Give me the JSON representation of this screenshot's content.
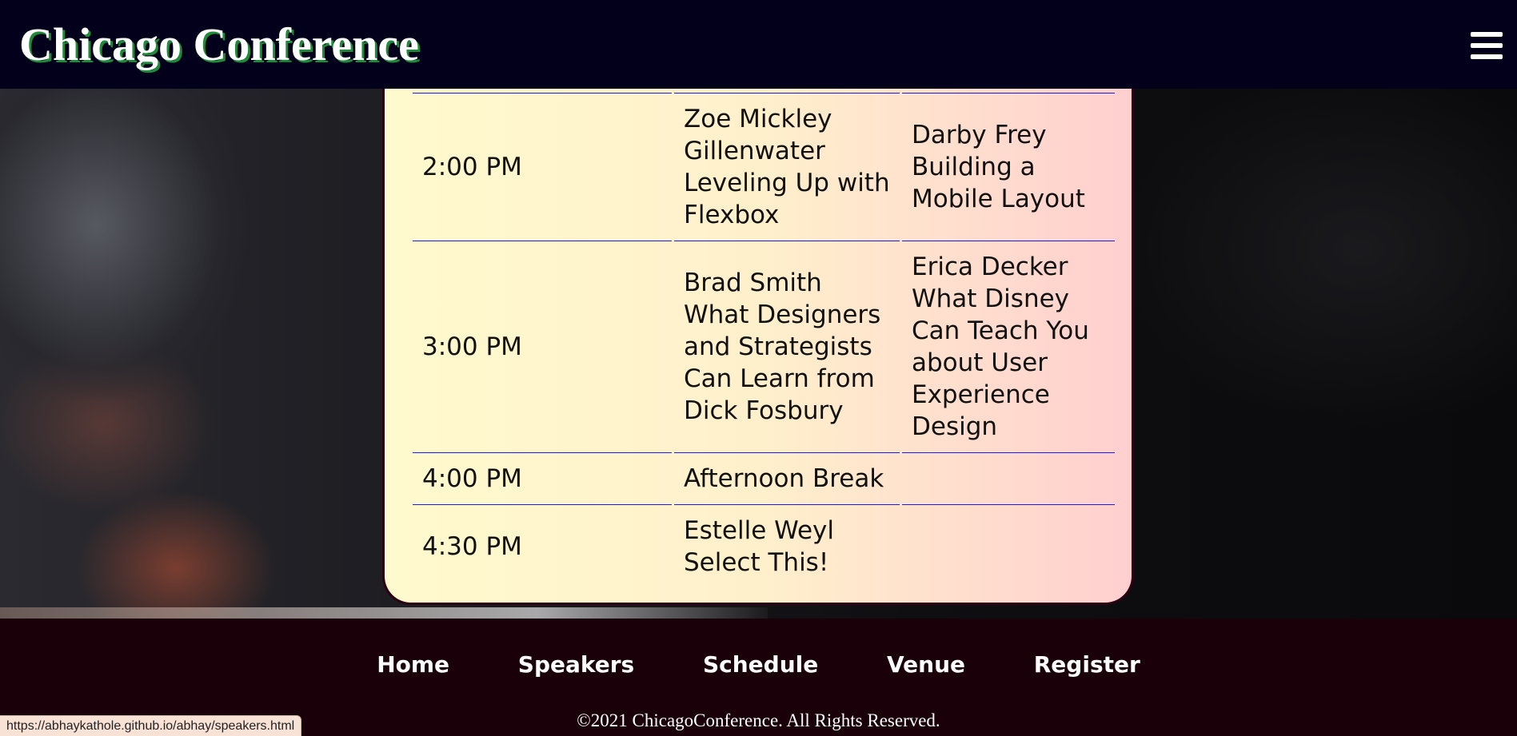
{
  "header": {
    "title": "Chicago Conference",
    "menu_icon": "hamburger-menu-icon"
  },
  "schedule": {
    "rows": [
      {
        "time": "2:00 PM",
        "a": "Zoe Mickley Gillenwater Leveling Up with Flexbox",
        "b": "Darby Frey Building a Mobile Layout"
      },
      {
        "time": "3:00 PM",
        "a": "Brad Smith What Designers and Strategists Can Learn from Dick Fosbury",
        "b": "Erica Decker What Disney Can Teach You about User Experience Design"
      },
      {
        "time": "4:00 PM",
        "a": "Afternoon Break",
        "b": ""
      },
      {
        "time": "4:30 PM",
        "a": "Estelle Weyl Select This!",
        "b": ""
      }
    ]
  },
  "footer": {
    "nav": [
      "Home",
      "Speakers",
      "Schedule",
      "Venue",
      "Register"
    ],
    "copyright": "©2021 ChicagoConference. All Rights Reserved."
  },
  "status_bar": {
    "url": "https://abhaykathole.github.io/abhay/speakers.html"
  },
  "colors": {
    "header_bg": "#02001a",
    "footer_bg": "#1a0008",
    "card_gradient_start": "#fffacd",
    "card_gradient_end": "#ffcfcf",
    "row_border": "#1a1aee",
    "title_shadow": "#1f8a3a"
  }
}
